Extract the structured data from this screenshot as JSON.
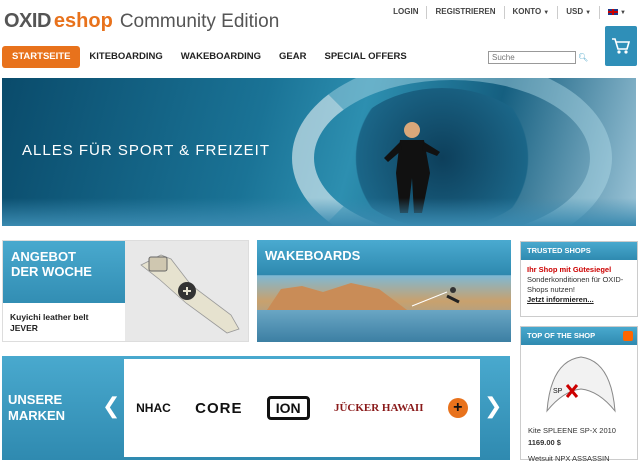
{
  "brand": {
    "logo_oxid": "OXID",
    "logo_eshop": "eshop",
    "edition": "Community Edition"
  },
  "top_nav": {
    "login": "LOGIN",
    "register": "REGISTRIEREN",
    "account": "KONTO",
    "currency": "USD"
  },
  "main_nav": [
    "STARTSEITE",
    "KITEBOARDING",
    "WAKEBOARDING",
    "GEAR",
    "SPECIAL OFFERS"
  ],
  "search": {
    "placeholder": "Suche"
  },
  "hero": {
    "tagline": "ALLES FÜR SPORT & FREIZEIT"
  },
  "promo": {
    "label_line1": "ANGEBOT",
    "label_line2": "DER WOCHE",
    "product_line1": "Kuyichi leather belt",
    "product_line2": "JEVER"
  },
  "wakeboards": {
    "label": "WAKEBOARDS"
  },
  "brands": {
    "label_line1": "UNSERE",
    "label_line2": "MARKEN",
    "logos": [
      "NHAC",
      "CORE",
      "ION",
      "JÜCKER HAWAII",
      "+"
    ]
  },
  "trusted_shops": {
    "header": "TRUSTED SHOPS",
    "title": "Ihr Shop mit Gütesiegel",
    "text": "Sonderkonditionen für OXID-Shops nutzen!",
    "link": "Jetzt informieren..."
  },
  "top_shop": {
    "header": "TOP OF THE SHOP",
    "product_name": "Kite SPLEENE SP-X 2010",
    "price": "1169.00 $",
    "next_product": "Wetsuit NPX ASSASSIN"
  },
  "colors": {
    "accent": "#e8721c",
    "primary_blue": "#2f8ab0"
  }
}
